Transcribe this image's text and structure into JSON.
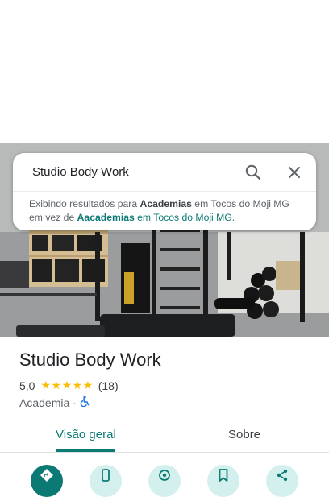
{
  "search": {
    "query": "Studio Body Work",
    "suggestion": {
      "prefix": "Exibindo resultados para ",
      "corrected_term": "Academias",
      "corrected_location": " em Tocos do Moji MG",
      "mid": "em vez de ",
      "original_term": "Aacademias",
      "original_location": " em Tocos do Moji MG",
      "end": "."
    }
  },
  "place": {
    "name": "Studio Body Work",
    "rating": "5,0",
    "stars": "★★★★★",
    "review_count": "(18)",
    "category": "Academia",
    "separator": "·"
  },
  "tabs": [
    {
      "label": "Visão geral",
      "selected": true
    },
    {
      "label": "Sobre",
      "selected": false
    }
  ],
  "actions": [
    {
      "icon": "directions-icon"
    },
    {
      "icon": "phone-icon"
    },
    {
      "icon": "location-icon"
    },
    {
      "icon": "save-icon"
    },
    {
      "icon": "share-icon"
    }
  ],
  "colors": {
    "accent": "#0b7a75",
    "star": "#fbbc04",
    "action_bg": "#d4f0ee",
    "accessible": "#1a73e8"
  }
}
